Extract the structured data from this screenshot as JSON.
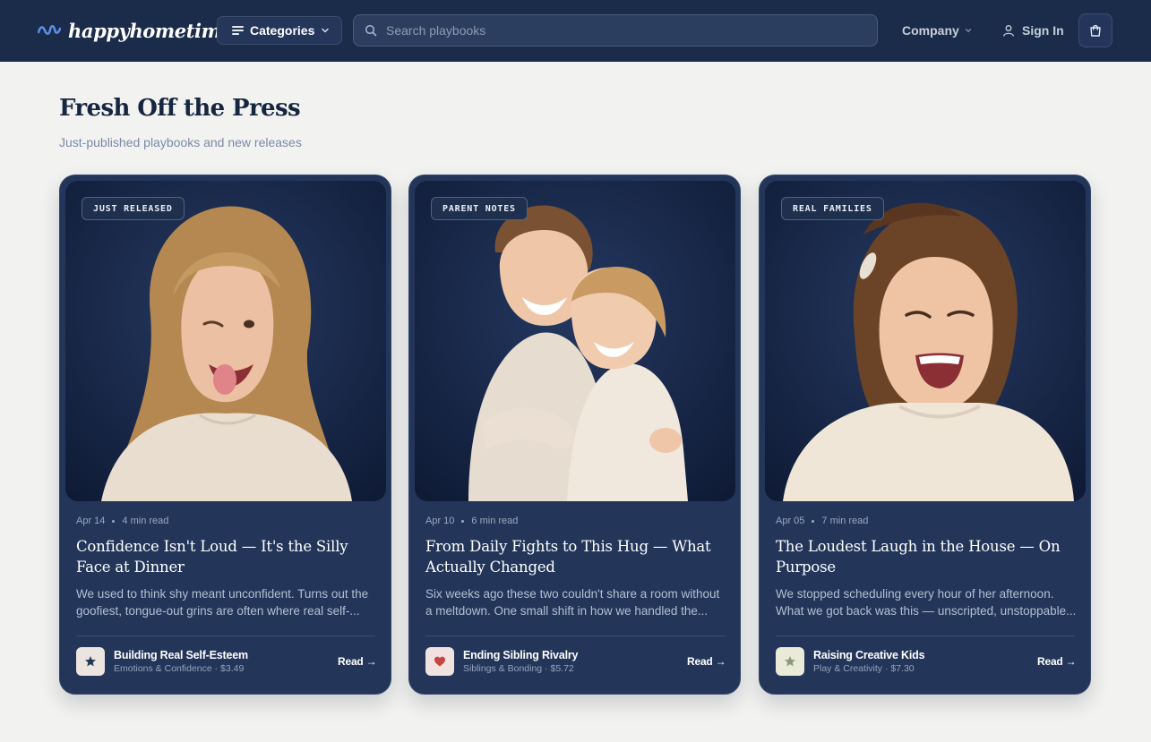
{
  "header": {
    "brand": "happyhometime",
    "categories_label": "Categories",
    "search_placeholder": "Search playbooks",
    "company_label": "Company",
    "signin_label": "Sign In"
  },
  "section": {
    "title": "Fresh Off the Press",
    "subtitle": "Just-published playbooks and new releases"
  },
  "cards": [
    {
      "badge": "JUST RELEASED",
      "date": "Apr 14",
      "read_time": "4 min read",
      "title": "Confidence Isn't Loud — It's the Silly Face at Dinner",
      "description": "We used to think shy meant unconfident. Turns out the goofiest, tongue-out grins are often where real self-...",
      "product_icon": "star-icon",
      "product_name": "Building Real Self-Esteem",
      "product_meta": "Emotions & Confidence · $3.49",
      "cta": "Read →"
    },
    {
      "badge": "PARENT NOTES",
      "date": "Apr 10",
      "read_time": "6 min read",
      "title": "From Daily Fights to This Hug — What Actually Changed",
      "description": "Six weeks ago these two couldn't share a room without a meltdown. One small shift in how we handled the...",
      "product_icon": "heart-icon",
      "product_name": "Ending Sibling Rivalry",
      "product_meta": "Siblings & Bonding · $5.72",
      "cta": "Read →"
    },
    {
      "badge": "REAL FAMILIES",
      "date": "Apr 05",
      "read_time": "7 min read",
      "title": "The Loudest Laugh in the House — On Purpose",
      "description": "We stopped scheduling every hour of her afternoon. What we got back was this — unscripted, unstoppable...",
      "product_icon": "star-icon",
      "product_name": "Raising Creative Kids",
      "product_meta": "Play & Creativity · $7.30",
      "cta": "Read →"
    }
  ],
  "colors": {
    "header_bg": "#1b2b4a",
    "card_bg": "#23365a",
    "page_bg": "#f2f2f0",
    "brand_wave": "#5b8ee6",
    "star_navy": "#23365a",
    "heart_red": "#c84442",
    "star_sage": "#8a9a78"
  }
}
